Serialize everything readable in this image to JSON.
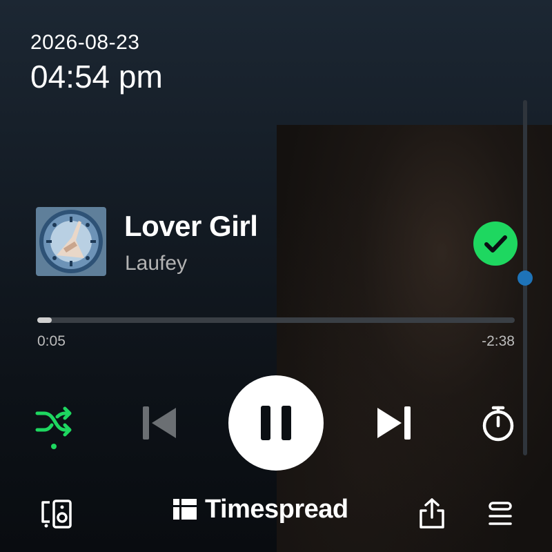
{
  "status": {
    "date": "2026-08-23",
    "time": "04:54 pm"
  },
  "track": {
    "title": "Lover Girl",
    "artist": "Laufey",
    "album_art_icon": "album-cover-clock",
    "liked": true
  },
  "progress": {
    "elapsed": "0:05",
    "remaining": "-2:38",
    "fraction": 0.03
  },
  "volume": {
    "level": 0.5
  },
  "controls": {
    "shuffle_icon": "shuffle-icon",
    "shuffle_active": true,
    "previous_icon": "skip-previous-icon",
    "play_state": "playing",
    "pause_icon": "pause-icon",
    "next_icon": "skip-next-icon",
    "timer_icon": "sleep-timer-icon"
  },
  "footer": {
    "devices_icon": "connect-device-icon",
    "brand_name": "Timespread",
    "share_icon": "share-icon",
    "queue_icon": "queue-icon"
  },
  "colors": {
    "accent_green": "#1ed760",
    "volume_blue": "#1e73b8",
    "disabled_gray": "#6b6f73"
  }
}
